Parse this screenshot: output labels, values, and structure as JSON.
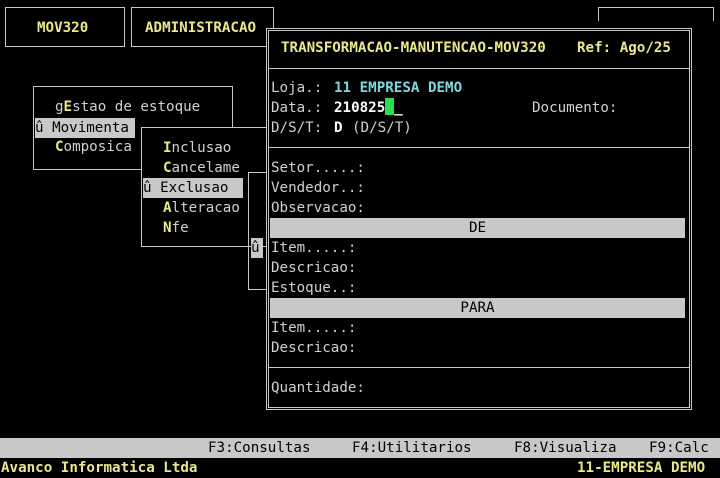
{
  "top_menu": {
    "item1": "MOV320",
    "item2": "ADMINISTRACAO"
  },
  "menu1": {
    "items": [
      {
        "prefix": "g",
        "hotkey": "E",
        "rest": "stao de estoque"
      },
      {
        "marker": "û ",
        "label": "Movimenta"
      },
      {
        "hotkey": "C",
        "rest": "omposica"
      }
    ]
  },
  "menu2": {
    "items": [
      {
        "hotkey": "I",
        "rest": "nclusao"
      },
      {
        "hotkey": "C",
        "rest": "ancelame"
      },
      {
        "marker": "û ",
        "label": "Exclusao"
      },
      {
        "hotkey": "A",
        "rest": "lteracao"
      },
      {
        "hotkey": "N",
        "rest": "fe"
      }
    ]
  },
  "menu3_marker": "û",
  "form": {
    "title": "TRANSFORMACAO-MANUTENCAO-MOV320",
    "ref": "Ref: Ago/25",
    "loja_label": "Loja.:",
    "loja_value": "11 EMPRESA DEMO",
    "data_label": "Data.:",
    "data_value": "210825",
    "data_trail": "_",
    "documento_label": "Documento:",
    "dst_label": "D/S/T:",
    "dst_value": "D",
    "dst_hint": "(D/S/T)",
    "setor_label": "Setor.....:",
    "vendedor_label": "Vendedor..:",
    "observacao_label": "Observacao:",
    "de_header": "DE",
    "item_de_label": "Item.....:",
    "descricao_de_label": "Descricao:",
    "estoque_label": "Estoque..:",
    "para_header": "PARA",
    "item_para_label": "Item.....:",
    "descricao_para_label": "Descricao:",
    "quantidade_label": "Quantidade:"
  },
  "function_keys": [
    {
      "key": "F3",
      "label": "F3:Consultas"
    },
    {
      "key": "F4",
      "label": "F4:Utilitarios"
    },
    {
      "key": "F8",
      "label": "F8:Visualiza"
    },
    {
      "key": "F9",
      "label": "F9:Calc"
    }
  ],
  "status": {
    "company_left": "Avanco Informatica Ltda",
    "company_right": "11-EMPRESA DEMO"
  },
  "colors": {
    "background": "#000000",
    "frame": "#c8c8c8",
    "highlight_yellow": "#e8e88c",
    "cyan": "#7fd7df",
    "cursor": "#29e04a"
  }
}
